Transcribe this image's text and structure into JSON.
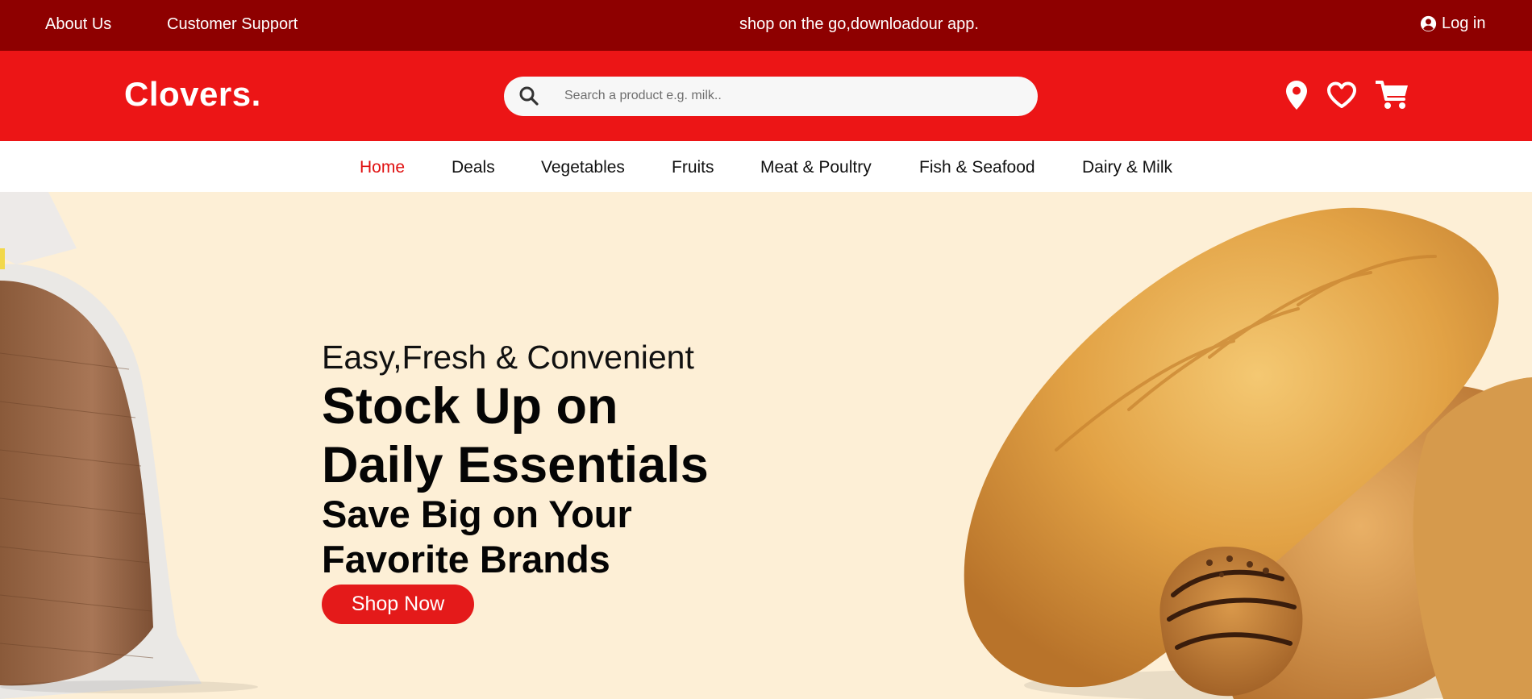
{
  "topbar": {
    "about": "About Us",
    "support": "Customer Support",
    "promo": "shop on the go,downloadour app.",
    "login": "Log in",
    "login_icon": "user-circle-icon"
  },
  "header": {
    "logo": "Clovers.",
    "search_placeholder": "Search a product e.g. milk..",
    "search_icon": "search-icon",
    "icons": [
      "location-pin-icon",
      "heart-icon",
      "shopping-cart-icon"
    ]
  },
  "nav": {
    "items": [
      "Home",
      "Deals",
      "Vegetables",
      "Fruits",
      "Meat & Poultry",
      "Fish & Seafood",
      "Dairy & Milk"
    ],
    "active": "Home"
  },
  "hero": {
    "tagline": "Easy,Fresh & Convenient",
    "headline": "Stock Up on Daily Essentials",
    "subheadline": "Save Big on Your Favorite Brands",
    "cta": "Shop Now"
  },
  "colors": {
    "topbar": "#8e0000",
    "header": "#ec1516",
    "accent": "#e41a1a",
    "hero_bg": "#fdefd6"
  }
}
